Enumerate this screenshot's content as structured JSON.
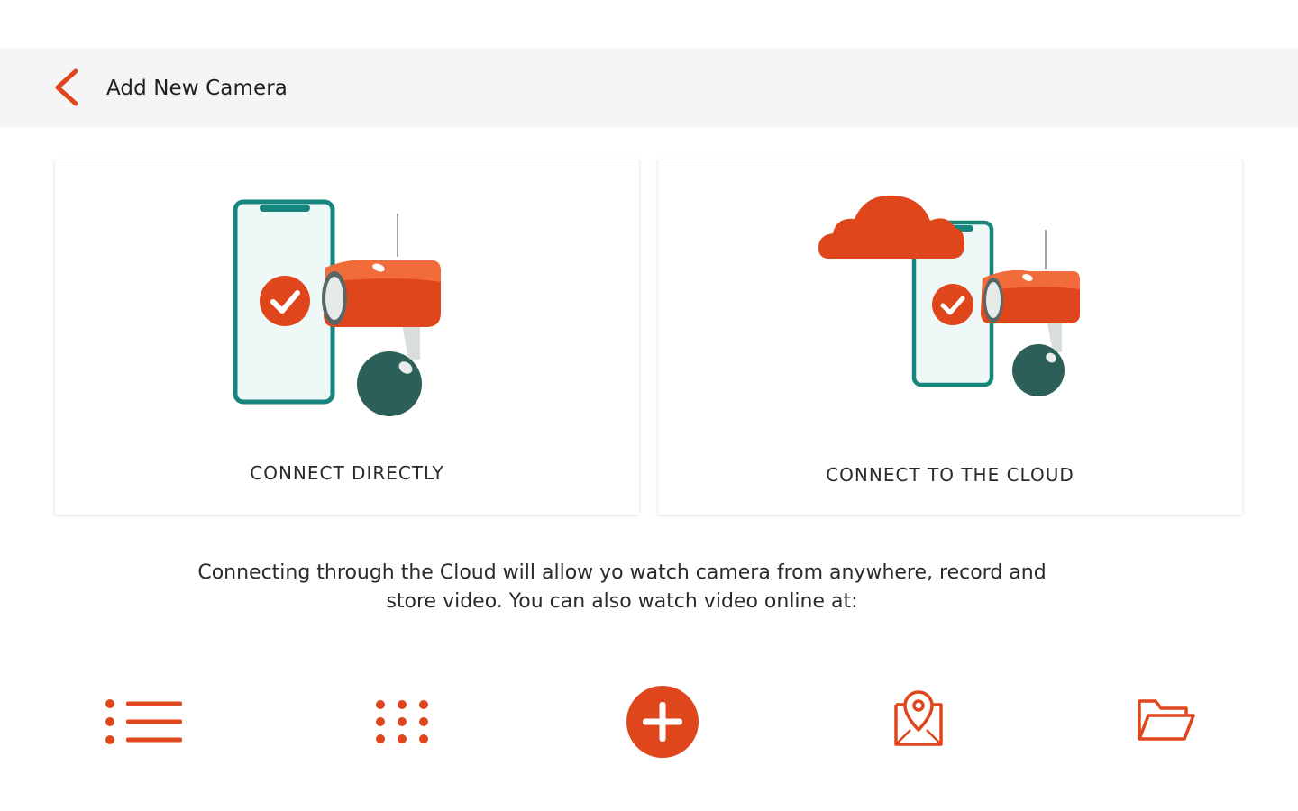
{
  "header": {
    "title": "Add New Camera",
    "back_icon": "chevron-left-icon"
  },
  "options": [
    {
      "label": "CONNECT DIRECTLY",
      "icon": "phone-camera-illustration"
    },
    {
      "label": "CONNECT TO THE CLOUD",
      "icon": "cloud-phone-camera-illustration"
    }
  ],
  "info": {
    "line1": "Connecting through the Cloud will allow yo watch camera from anywhere, record and",
    "line2": "store video. You can also watch video online at:"
  },
  "bottom_nav": [
    {
      "icon": "list-icon"
    },
    {
      "icon": "grid-icon"
    },
    {
      "icon": "add-icon"
    },
    {
      "icon": "map-pin-icon"
    },
    {
      "icon": "folder-icon"
    }
  ],
  "colors": {
    "accent": "#e0461c",
    "teal": "#16857d",
    "dark_teal": "#2b5f58",
    "header_bg": "#f5f5f5"
  }
}
